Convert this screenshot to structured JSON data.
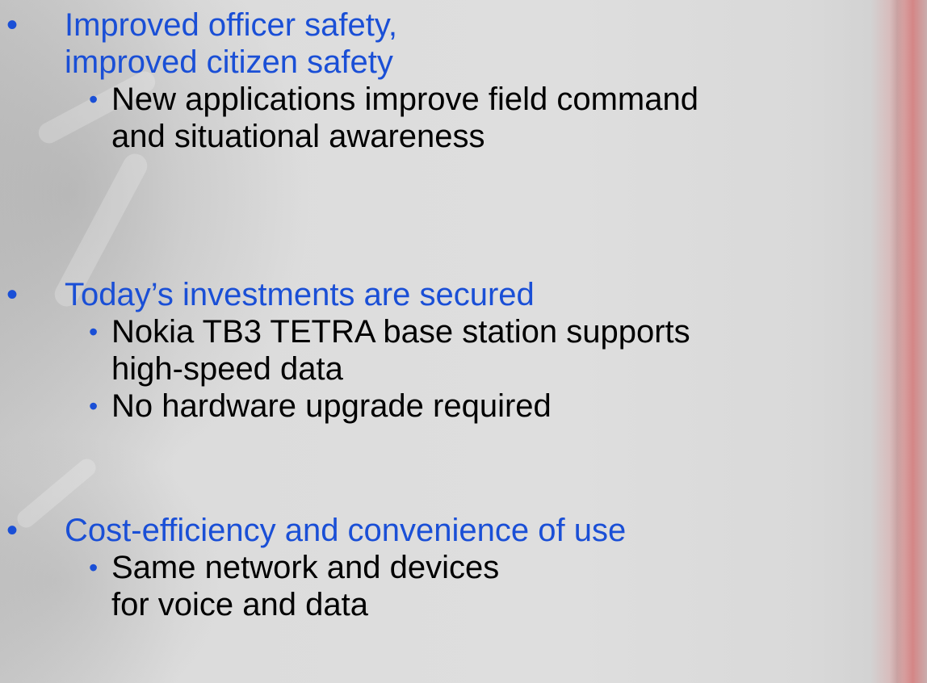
{
  "slide": {
    "bullets": [
      {
        "lines": [
          "Improved officer safety,",
          "improved citizen safety"
        ],
        "sub": [
          {
            "lines": [
              "New applications improve field command",
              "and situational awareness"
            ]
          }
        ]
      },
      {
        "lines": [
          "Today’s investments are secured"
        ],
        "sub": [
          {
            "lines": [
              "Nokia TB3 TETRA base station supports",
              "high-speed data"
            ]
          },
          {
            "lines": [
              "No hardware upgrade required"
            ]
          }
        ]
      },
      {
        "lines": [
          "Cost-efficiency and convenience of use"
        ],
        "sub": [
          {
            "lines": [
              "Same network and devices",
              "for voice and data"
            ]
          }
        ]
      }
    ],
    "bullet_glyph": "•"
  },
  "colors": {
    "heading_bullet": "#1a4fd6",
    "sub_bullet_text": "#000000",
    "background": "#d6d6d6",
    "edge_accent": "#d46e6e"
  }
}
